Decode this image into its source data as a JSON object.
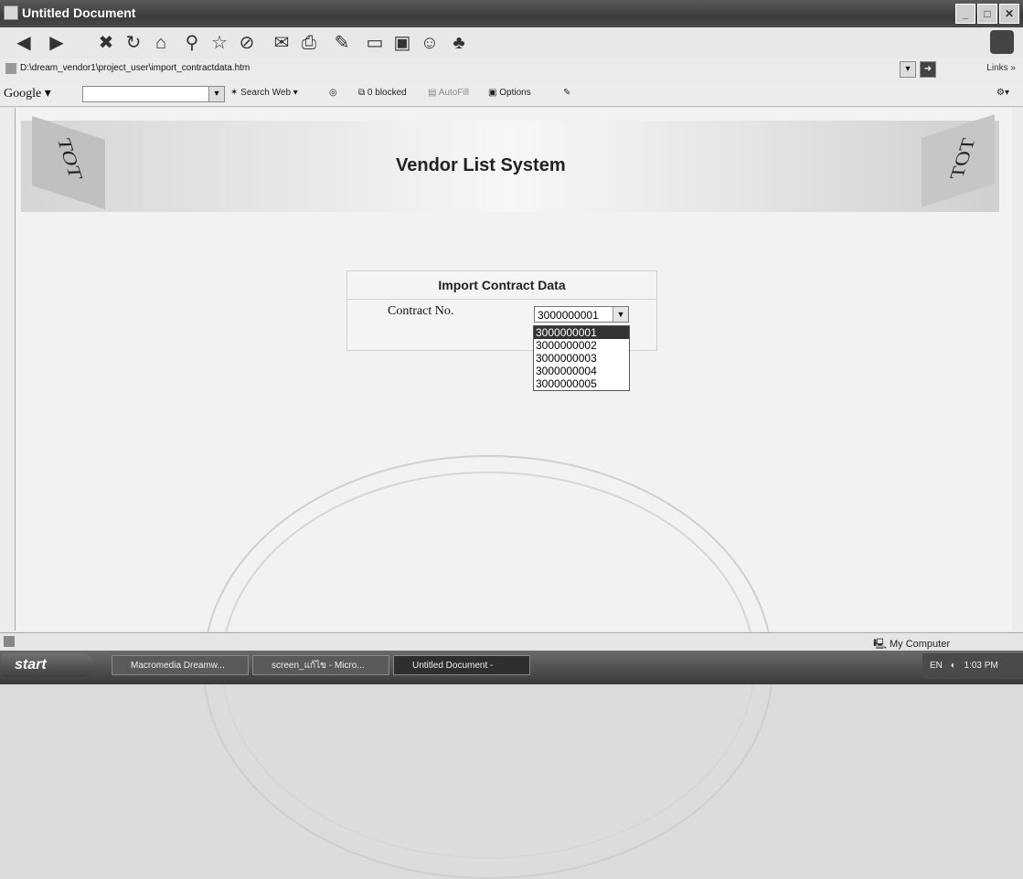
{
  "window": {
    "title": "Untitled Document"
  },
  "address": {
    "url": "D:\\dream_vendor1\\project_user\\import_contractdata.htm",
    "links_label": "Links"
  },
  "google": {
    "logo": "Google",
    "search_web": "Search Web",
    "blocked": "0 blocked",
    "autofill": "AutoFill",
    "options": "Options"
  },
  "banner": {
    "title": "Vendor List System",
    "logo_text": "TOT"
  },
  "form": {
    "title": "Import Contract Data",
    "contract_label": "Contract No.",
    "selected": "3000000001",
    "options": [
      "3000000001",
      "3000000002",
      "3000000003",
      "3000000004",
      "3000000005"
    ]
  },
  "status": {
    "zone": "My Computer"
  },
  "taskbar": {
    "start": "start",
    "tasks": [
      "Macromedia Dreamw...",
      "screen_แก้ไข - Micro...",
      "Untitled Document -"
    ],
    "lang": "EN",
    "clock": "1:03 PM"
  }
}
